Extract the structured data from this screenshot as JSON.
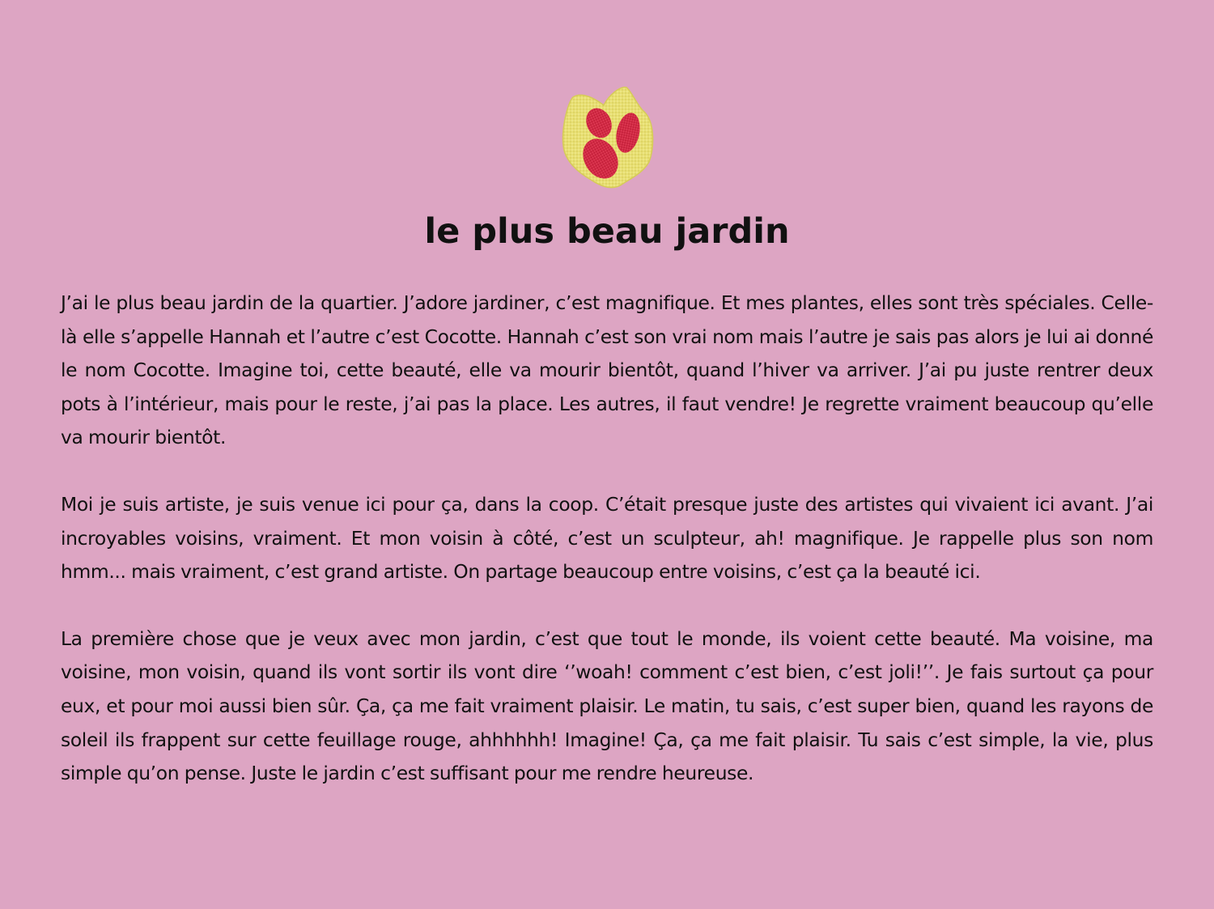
{
  "logo": {
    "icon": "berry-leaf-icon",
    "colors": {
      "leaf": "#e6dc6e",
      "berry": "#d42a45"
    }
  },
  "title": "le plus beau jardin",
  "paragraphs": [
    "J’ai le plus beau jardin de la quartier. J’adore jardiner, c’est magnifique. Et mes plantes, elles sont très spéciales. Celle-là elle s’appelle Hannah et l’autre c’est Cocotte. Hannah c’est son vrai nom mais l’autre je sais pas alors je lui ai donné le nom Cocotte. Imagine toi, cette beauté, elle va mourir bientôt, quand l’hiver va arriver. J’ai pu juste rentrer deux pots à l’intérieur, mais pour le reste, j’ai pas la place. Les autres, il faut vendre! Je regrette vraiment beaucoup qu’elle va mourir bientôt.",
    "Moi je suis artiste, je suis venue ici pour ça, dans la coop. C’était presque juste des artistes qui vivaient ici avant. J’ai incroyables voisins, vraiment. Et mon voisin à côté, c’est un sculpteur, ah! magnifique. Je rappelle plus son nom hmm... mais vraiment, c’est grand artiste. On partage beaucoup entre voisins, c’est ça la beauté ici.",
    "La première chose que je veux avec mon jardin, c’est que tout le monde, ils voient cette beauté. Ma voisine, ma voisine, mon voisin, quand ils vont sortir ils vont dire ‘’woah! comment c’est bien, c’est joli!’’. Je fais surtout ça pour eux, et pour moi aussi bien sûr. Ça, ça me fait vraiment plaisir. Le matin, tu sais, c’est super bien, quand les rayons de soleil ils frappent sur cette feuillage rouge, ahhhhhh! Imagine! Ça, ça me fait plaisir. Tu sais c’est simple, la vie, plus simple qu’on pense. Juste le jardin c’est suffisant pour me rendre heureuse."
  ]
}
